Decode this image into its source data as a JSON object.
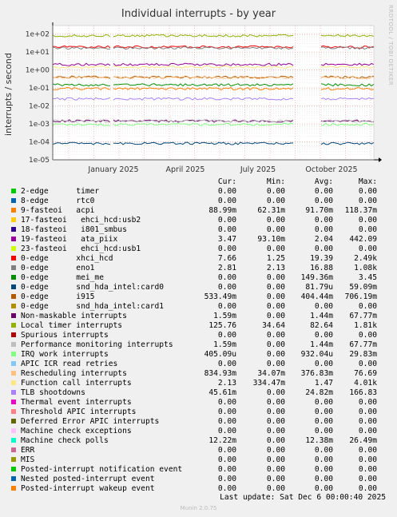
{
  "title": "Individual interrupts - by year",
  "side_text": "RRDTOOL / TOBI OETIKER",
  "chart_data": {
    "type": "line",
    "ylabel": "interrupts / second",
    "yscale": "log",
    "ylim": [
      1e-05,
      300
    ],
    "yticks": [
      "1e+02",
      "1e+01",
      "1e+00",
      "1e-01",
      "1e-02",
      "1e-03",
      "1e-04",
      "1e-05"
    ],
    "xticks": [
      "January 2025",
      "April 2025",
      "July 2025",
      "October 2025"
    ],
    "series": [
      {
        "name": "timer",
        "values": [
          0,
          0,
          0,
          0
        ]
      },
      {
        "name": "rtc0",
        "values": [
          0,
          0,
          0,
          0
        ]
      },
      {
        "name": "acpi",
        "values": [
          0.08899,
          0.06231,
          0.0917,
          0.11837
        ]
      },
      {
        "name": "ehci_hcd:usb2",
        "values": [
          0,
          0,
          0,
          0
        ]
      },
      {
        "name": "i801_smbus",
        "values": [
          0,
          0,
          0,
          0
        ]
      },
      {
        "name": "ata_piix",
        "values": [
          3.47,
          0.0931,
          2.04,
          442.09
        ]
      },
      {
        "name": "ehci_hcd:usb1",
        "values": [
          0,
          0,
          0,
          0
        ]
      },
      {
        "name": "xhci_hcd",
        "values": [
          7.66,
          1.25,
          19.39,
          2490
        ]
      },
      {
        "name": "eno1",
        "values": [
          2.81,
          2.13,
          16.88,
          1080
        ]
      },
      {
        "name": "mei_me",
        "values": [
          0,
          0,
          0.14936,
          3.45
        ]
      },
      {
        "name": "snd_hda_intel:card0",
        "values": [
          0,
          0,
          8.179e-05,
          0.05909
        ]
      },
      {
        "name": "i915",
        "values": [
          0.53349,
          0,
          0.40444,
          0.70619
        ]
      },
      {
        "name": "snd_hda_intel:card1",
        "values": [
          0,
          0,
          0,
          0
        ]
      },
      {
        "name": "Non-maskable interrupts",
        "values": [
          0.00159,
          0,
          0.00144,
          0.06777
        ]
      },
      {
        "name": "Local timer interrupts",
        "values": [
          125.76,
          34.64,
          82.64,
          1810
        ]
      },
      {
        "name": "Spurious interrupts",
        "values": [
          0,
          0,
          0,
          0
        ]
      },
      {
        "name": "Performance monitoring interrupts",
        "values": [
          0.00159,
          0,
          0.00144,
          0.06777
        ]
      },
      {
        "name": "IRQ work interrupts",
        "values": [
          0.000405,
          0,
          0.000932,
          0.02983
        ]
      },
      {
        "name": "APIC ICR read retries",
        "values": [
          0,
          0,
          0,
          0
        ]
      },
      {
        "name": "Rescheduling interrupts",
        "values": [
          0.83493,
          0.03407,
          0.37683,
          76.69
        ]
      },
      {
        "name": "Function call interrupts",
        "values": [
          2.13,
          0.33447,
          1.47,
          4010
        ]
      },
      {
        "name": "TLB shootdowns",
        "values": [
          0.04561,
          0,
          0.02482,
          0.16683
        ]
      }
    ]
  },
  "legend": {
    "headers": {
      "cur": "Cur:",
      "min": "Min:",
      "avg": "Avg:",
      "max": "Max:"
    },
    "rows": [
      {
        "color": "#00cc00",
        "label": "2-edge      timer",
        "cur": "0.00",
        "min": "0.00",
        "avg": "0.00",
        "max": "0.00"
      },
      {
        "color": "#0066b3",
        "label": "8-edge      rtc0",
        "cur": "0.00",
        "min": "0.00",
        "avg": "0.00",
        "max": "0.00"
      },
      {
        "color": "#ff8000",
        "label": "9-fasteoi   acpi",
        "cur": "88.99m",
        "min": "62.31m",
        "avg": "91.70m",
        "max": "118.37m"
      },
      {
        "color": "#ffcc00",
        "label": "17-fasteoi   ehci_hcd:usb2",
        "cur": "0.00",
        "min": "0.00",
        "avg": "0.00",
        "max": "0.00"
      },
      {
        "color": "#330099",
        "label": "18-fasteoi   i801_smbus",
        "cur": "0.00",
        "min": "0.00",
        "avg": "0.00",
        "max": "0.00"
      },
      {
        "color": "#990099",
        "label": "19-fasteoi   ata_piix",
        "cur": "3.47",
        "min": "93.10m",
        "avg": "2.04",
        "max": "442.09"
      },
      {
        "color": "#ccff00",
        "label": "23-fasteoi   ehci_hcd:usb1",
        "cur": "0.00",
        "min": "0.00",
        "avg": "0.00",
        "max": "0.00"
      },
      {
        "color": "#ff0000",
        "label": "0-edge      xhci_hcd",
        "cur": "7.66",
        "min": "1.25",
        "avg": "19.39",
        "max": "2.49k"
      },
      {
        "color": "#808080",
        "label": "0-edge      eno1",
        "cur": "2.81",
        "min": "2.13",
        "avg": "16.88",
        "max": "1.08k"
      },
      {
        "color": "#008f00",
        "label": "0-edge      mei_me",
        "cur": "0.00",
        "min": "0.00",
        "avg": "149.36m",
        "max": "3.45"
      },
      {
        "color": "#00487d",
        "label": "0-edge      snd_hda_intel:card0",
        "cur": "0.00",
        "min": "0.00",
        "avg": "81.79u",
        "max": "59.09m"
      },
      {
        "color": "#b35a00",
        "label": "0-edge      i915",
        "cur": "533.49m",
        "min": "0.00",
        "avg": "404.44m",
        "max": "706.19m"
      },
      {
        "color": "#b38f00",
        "label": "0-edge      snd_hda_intel:card1",
        "cur": "0.00",
        "min": "0.00",
        "avg": "0.00",
        "max": "0.00"
      },
      {
        "color": "#6b006b",
        "label": "Non-maskable interrupts",
        "cur": "1.59m",
        "min": "0.00",
        "avg": "1.44m",
        "max": "67.77m"
      },
      {
        "color": "#8fb300",
        "label": "Local timer interrupts",
        "cur": "125.76",
        "min": "34.64",
        "avg": "82.64",
        "max": "1.81k"
      },
      {
        "color": "#b30000",
        "label": "Spurious interrupts",
        "cur": "0.00",
        "min": "0.00",
        "avg": "0.00",
        "max": "0.00"
      },
      {
        "color": "#bebebe",
        "label": "Performance monitoring interrupts",
        "cur": "1.59m",
        "min": "0.00",
        "avg": "1.44m",
        "max": "67.77m"
      },
      {
        "color": "#80ff80",
        "label": "IRQ work interrupts",
        "cur": "405.09u",
        "min": "0.00",
        "avg": "932.04u",
        "max": "29.83m"
      },
      {
        "color": "#80c9ff",
        "label": "APIC ICR read retries",
        "cur": "0.00",
        "min": "0.00",
        "avg": "0.00",
        "max": "0.00"
      },
      {
        "color": "#ffc080",
        "label": "Rescheduling interrupts",
        "cur": "834.93m",
        "min": "34.07m",
        "avg": "376.83m",
        "max": "76.69"
      },
      {
        "color": "#ffe680",
        "label": "Function call interrupts",
        "cur": "2.13",
        "min": "334.47m",
        "avg": "1.47",
        "max": "4.01k"
      },
      {
        "color": "#aa80ff",
        "label": "TLB shootdowns",
        "cur": "45.61m",
        "min": "0.00",
        "avg": "24.82m",
        "max": "166.83"
      },
      {
        "color": "#ee00cc",
        "label": "Thermal event interrupts",
        "cur": "0.00",
        "min": "0.00",
        "avg": "0.00",
        "max": "0.00"
      },
      {
        "color": "#ff8080",
        "label": "Threshold APIC interrupts",
        "cur": "0.00",
        "min": "0.00",
        "avg": "0.00",
        "max": "0.00"
      },
      {
        "color": "#666600",
        "label": "Deferred Error APIC interrupts",
        "cur": "0.00",
        "min": "0.00",
        "avg": "0.00",
        "max": "0.00"
      },
      {
        "color": "#ffbfff",
        "label": "Machine check exceptions",
        "cur": "0.00",
        "min": "0.00",
        "avg": "0.00",
        "max": "0.00"
      },
      {
        "color": "#00ffcc",
        "label": "Machine check polls",
        "cur": "12.22m",
        "min": "0.00",
        "avg": "12.38m",
        "max": "26.49m"
      },
      {
        "color": "#cc6699",
        "label": "ERR",
        "cur": "0.00",
        "min": "0.00",
        "avg": "0.00",
        "max": "0.00"
      },
      {
        "color": "#999900",
        "label": "MIS",
        "cur": "0.00",
        "min": "0.00",
        "avg": "0.00",
        "max": "0.00"
      },
      {
        "color": "#00cc00",
        "label": "Posted-interrupt notification event",
        "cur": "0.00",
        "min": "0.00",
        "avg": "0.00",
        "max": "0.00"
      },
      {
        "color": "#0066b3",
        "label": "Nested posted-interrupt event",
        "cur": "0.00",
        "min": "0.00",
        "avg": "0.00",
        "max": "0.00"
      },
      {
        "color": "#ff8000",
        "label": "Posted-interrupt wakeup event",
        "cur": "0.00",
        "min": "0.00",
        "avg": "0.00",
        "max": "0.00"
      }
    ]
  },
  "last_update": "Last update: Sat Dec  6 00:00:40 2025",
  "footer": "Munin 2.0.75"
}
